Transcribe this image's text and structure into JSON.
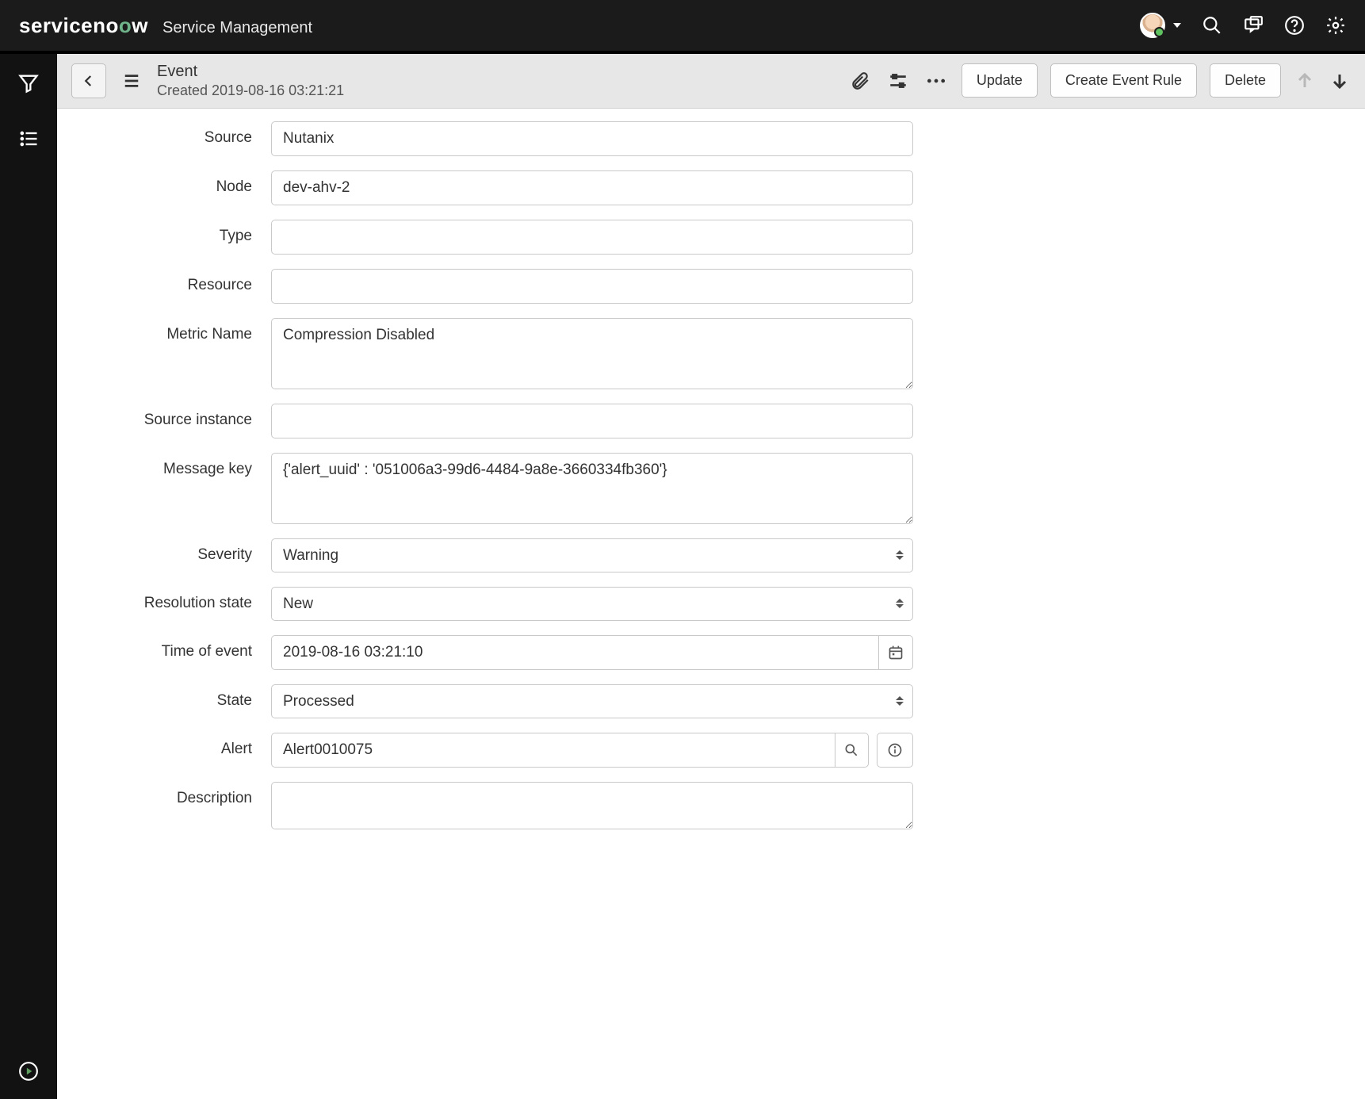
{
  "header": {
    "product": "Service Management"
  },
  "formHeader": {
    "recordType": "Event",
    "subtitle": "Created 2019-08-16 03:21:21",
    "actions": {
      "update": "Update",
      "createRule": "Create Event Rule",
      "delete": "Delete"
    }
  },
  "form": {
    "labels": {
      "source": "Source",
      "node": "Node",
      "type": "Type",
      "resource": "Resource",
      "metricName": "Metric Name",
      "sourceInstance": "Source instance",
      "messageKey": "Message key",
      "severity": "Severity",
      "resolutionState": "Resolution state",
      "timeOfEvent": "Time of event",
      "state": "State",
      "alert": "Alert",
      "description": "Description"
    },
    "values": {
      "source": "Nutanix",
      "node": "dev-ahv-2",
      "type": "",
      "resource": "",
      "metricName": "Compression Disabled",
      "sourceInstance": "",
      "messageKey": "{'alert_uuid' : '051006a3-99d6-4484-9a8e-3660334fb360'}",
      "severity": "Warning",
      "resolutionState": "New",
      "timeOfEvent": "2019-08-16 03:21:10",
      "state": "Processed",
      "alert": "Alert0010075",
      "description": ""
    }
  }
}
